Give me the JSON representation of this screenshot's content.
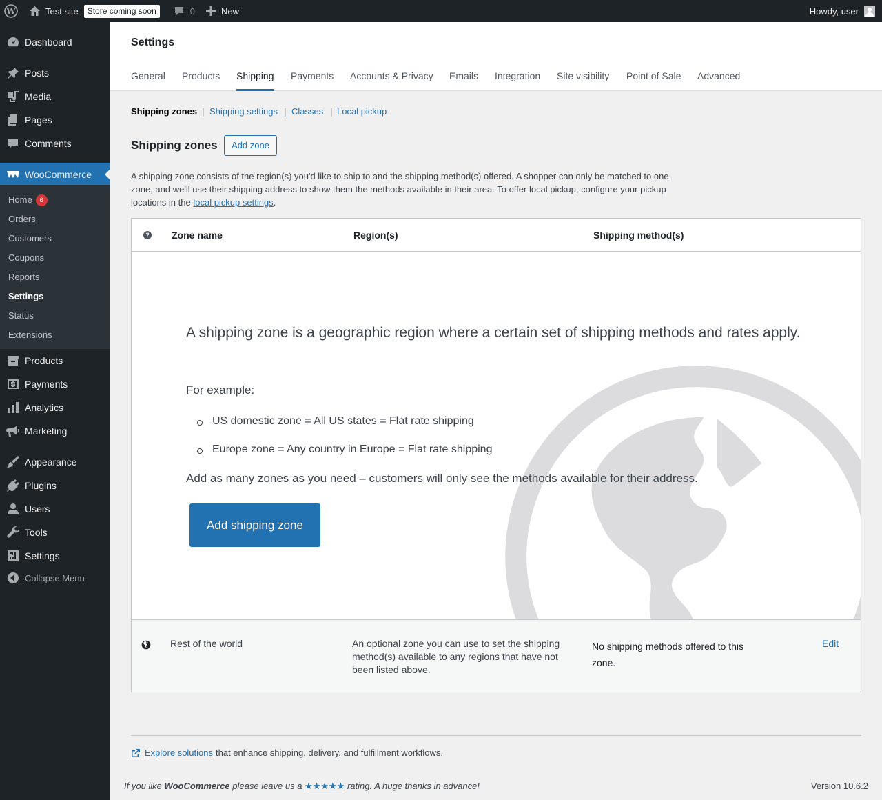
{
  "adminbar": {
    "site_name": "Test site",
    "store_badge": "Store coming soon",
    "comments_count": "0",
    "new_label": "New",
    "howdy": "Howdy, user"
  },
  "sidebar": {
    "items": {
      "dashboard": "Dashboard",
      "posts": "Posts",
      "media": "Media",
      "pages": "Pages",
      "comments": "Comments",
      "woocommerce": "WooCommerce",
      "products": "Products",
      "payments": "Payments",
      "analytics": "Analytics",
      "marketing": "Marketing",
      "appearance": "Appearance",
      "plugins": "Plugins",
      "users": "Users",
      "tools": "Tools",
      "settings": "Settings",
      "collapse": "Collapse Menu"
    },
    "woo_submenu": {
      "home": "Home",
      "home_badge": "6",
      "orders": "Orders",
      "customers": "Customers",
      "coupons": "Coupons",
      "reports": "Reports",
      "settings": "Settings",
      "status": "Status",
      "extensions": "Extensions"
    }
  },
  "header": {
    "title": "Settings",
    "tabs": {
      "general": "General",
      "products": "Products",
      "shipping": "Shipping",
      "payments": "Payments",
      "accounts": "Accounts & Privacy",
      "emails": "Emails",
      "integration": "Integration",
      "site_visibility": "Site visibility",
      "pos": "Point of Sale",
      "advanced": "Advanced"
    }
  },
  "subsub": {
    "zones": "Shipping zones",
    "settings": "Shipping settings",
    "classes": "Classes",
    "local_pickup": "Local pickup",
    "sep": "|"
  },
  "zones": {
    "heading": "Shipping zones",
    "add_zone": "Add zone",
    "description_pre": "A shipping zone consists of the region(s) you'd like to ship to and the shipping method(s) offered. A shopper can only be matched to one zone, and we'll use their shipping address to show them the methods available in their area. To offer local pickup, configure your pickup locations in the ",
    "description_link": "local pickup settings",
    "description_post": "."
  },
  "table": {
    "help": "?",
    "col_name": "Zone name",
    "col_regions": "Region(s)",
    "col_methods": "Shipping method(s)",
    "blank": {
      "title": "A shipping zone is a geographic region where a certain set of shipping methods and rates apply.",
      "example": "For example:",
      "li1": "US domestic zone = All US states = Flat rate shipping",
      "li2": "Europe zone = Any country in Europe = Flat rate shipping",
      "more": "Add as many zones as you need – customers will only see the methods available for their address.",
      "button": "Add shipping zone"
    },
    "rest_of_world": {
      "name": "Rest of the world",
      "region": "An optional zone you can use to set the shipping method(s) available to any regions that have not been listed above.",
      "methods": "No shipping methods offered to this zone.",
      "edit": "Edit"
    }
  },
  "footer": {
    "explore_link": "Explore solutions",
    "explore_text": "that enhance shipping, delivery, and fulfillment workflows.",
    "rate_pre": "If you like ",
    "rate_brand": "WooCommerce",
    "rate_mid": " please leave us a ",
    "rate_stars": "★★★★★",
    "rate_post": " rating. A huge thanks in advance!",
    "version": "Version 10.6.2"
  },
  "colors": {
    "accent": "#2271b1",
    "admin_bg": "#1d2327",
    "badge": "#d63638"
  },
  "icons": [
    "wordpress-logo-icon",
    "home-icon",
    "comment-icon",
    "plus-icon",
    "dashboard-icon",
    "pin-icon",
    "media-icon",
    "pages-icon",
    "comments-icon",
    "woo-icon",
    "archive-icon",
    "money-icon",
    "chart-bar-icon",
    "megaphone-icon",
    "brush-icon",
    "plug-icon",
    "user-icon",
    "wrench-icon",
    "settings-icon",
    "collapse-icon",
    "globe-icon",
    "external-link-icon"
  ]
}
